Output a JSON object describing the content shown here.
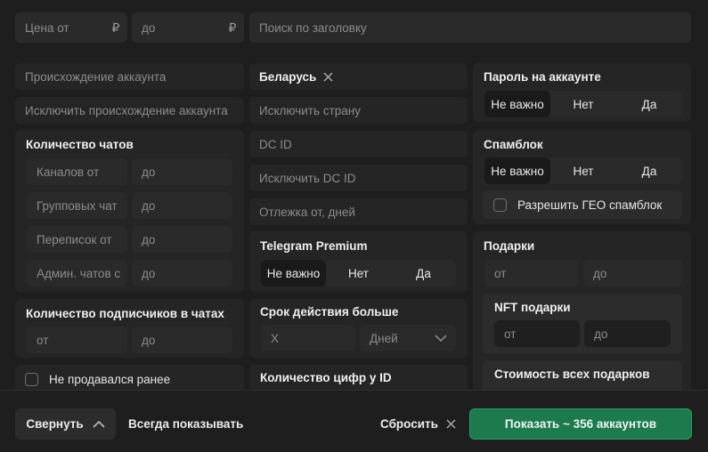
{
  "top": {
    "price_from": {
      "placeholder": "Цена от",
      "currency": "₽"
    },
    "price_to": {
      "placeholder": "до",
      "currency": "₽"
    },
    "title_search": {
      "placeholder": "Поиск по заголовку"
    }
  },
  "left": {
    "origin": "Происхождение аккаунта",
    "exclude_origin": "Исключить происхождение аккаунта",
    "chats": {
      "title": "Количество чатов",
      "rows": [
        {
          "from": "Каналов от",
          "to": "до"
        },
        {
          "from": "Групповых чат",
          "to": "до"
        },
        {
          "from": "Переписок от",
          "to": "до"
        },
        {
          "from": "Админ. чатов с",
          "to": "до"
        }
      ]
    },
    "subscribers": {
      "title": "Количество подписчиков в чатах",
      "from": "от",
      "to": "до"
    },
    "not_sold": "Не продавался ранее"
  },
  "middle": {
    "country_chip": "Беларусь",
    "exclude_country": "Исключить страну",
    "dc_id": "DC ID",
    "exclude_dc_id": "Исключить DC ID",
    "rest_from": "Отлежка от, дней",
    "premium": {
      "title": "Telegram Premium",
      "options": [
        "Не важно",
        "Нет",
        "Да"
      ]
    },
    "validity": {
      "title": "Срок действия больше",
      "value_placeholder": "X",
      "unit": "Дней"
    },
    "id_digits": {
      "title": "Количество цифр у ID"
    }
  },
  "right": {
    "password": {
      "title": "Пароль на аккаунте",
      "options": [
        "Не важно",
        "Нет",
        "Да"
      ]
    },
    "spamblock": {
      "title": "Спамблок",
      "options": [
        "Не важно",
        "Нет",
        "Да"
      ],
      "geo_label": "Разрешить ГЕО спамблок"
    },
    "gifts": {
      "title": "Подарки",
      "from": "от",
      "to": "до"
    },
    "nft_gifts": {
      "title": "NFT подарки",
      "from": "от",
      "to": "до"
    },
    "gifts_value": {
      "title": "Стоимость всех подарков"
    }
  },
  "footer": {
    "collapse": "Свернуть",
    "always_show": "Всегда показывать",
    "reset": "Сбросить",
    "show": "Показать ~ 356 аккаунтов"
  }
}
